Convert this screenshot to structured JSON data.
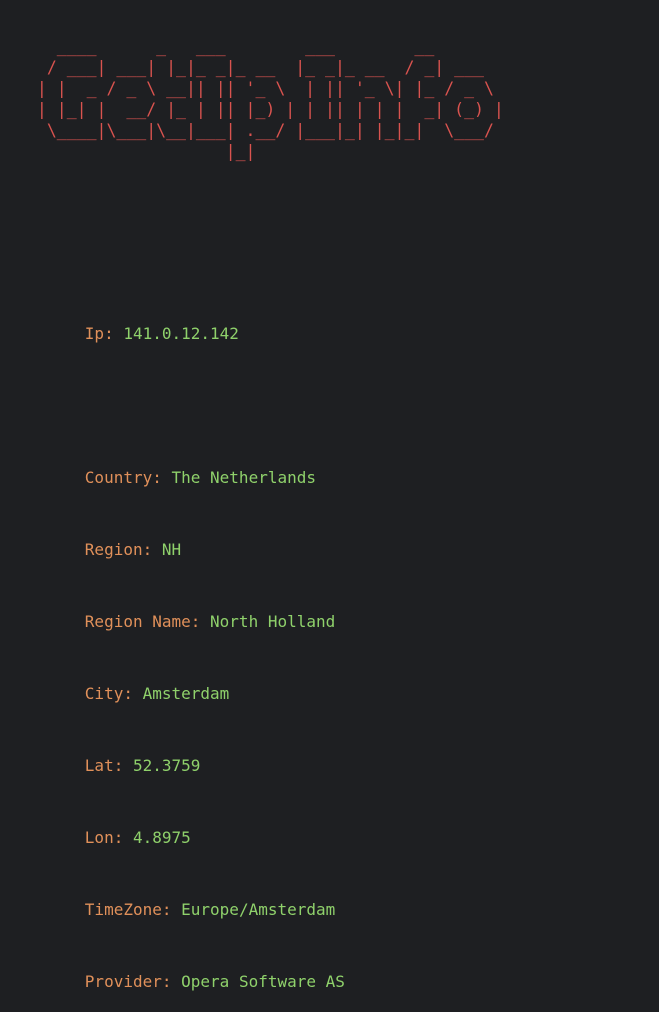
{
  "colors": {
    "background": "#1e1f22",
    "banner": "#d9534f",
    "key": "#e0905a",
    "value": "#8fd16b"
  },
  "banner": {
    "text": "   ____      _   ___        ___        __\n  / ___| ___| |_|_ _|_ __  |_ _|_ __  / _| ___\n | |  _ / _ \\ __|| || '_ \\  | || '_ \\| |_ / _ \\\n | |_| |  __/ |_ | || |_) | | || | | |  _| (_) |\n  \\____|\\___|\\__|___| .__/ |___|_| |_|_|  \\___/\n                    |_|"
  },
  "info": {
    "ip": {
      "key": "Ip:",
      "value": "141.0.12.142"
    },
    "fields": [
      {
        "key": "Country:",
        "value": "The Netherlands"
      },
      {
        "key": "Region:",
        "value": "NH"
      },
      {
        "key": "Region Name:",
        "value": "North Holland"
      },
      {
        "key": "City:",
        "value": "Amsterdam"
      },
      {
        "key": "Lat:",
        "value": "52.3759"
      },
      {
        "key": "Lon:",
        "value": "4.8975"
      },
      {
        "key": "TimeZone:",
        "value": "Europe/Amsterdam"
      },
      {
        "key": "Provider:",
        "value": "Opera Software AS"
      }
    ]
  }
}
